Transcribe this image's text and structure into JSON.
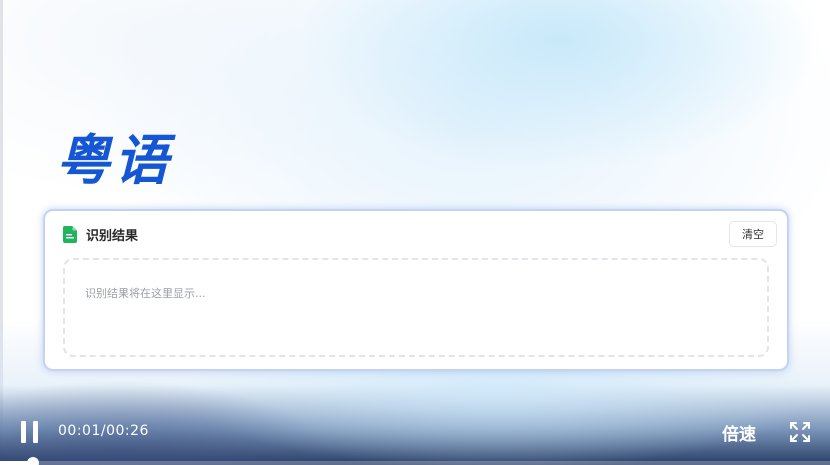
{
  "page": {
    "title": "粤语"
  },
  "result_card": {
    "title": "识别结果",
    "clear_label": "清空",
    "placeholder": "识别结果将在这里显示..."
  },
  "player": {
    "time": "00:01/00:26",
    "speed_label": "倍速",
    "progress": 0.04,
    "state": "playing"
  },
  "icons": {
    "file": "file-document-icon",
    "pause": "pause-icon",
    "fullscreen": "fullscreen-icon"
  },
  "colors": {
    "title": "#1556d4",
    "file_icon": "#22b35e",
    "card_border": "#c4d3f4"
  }
}
